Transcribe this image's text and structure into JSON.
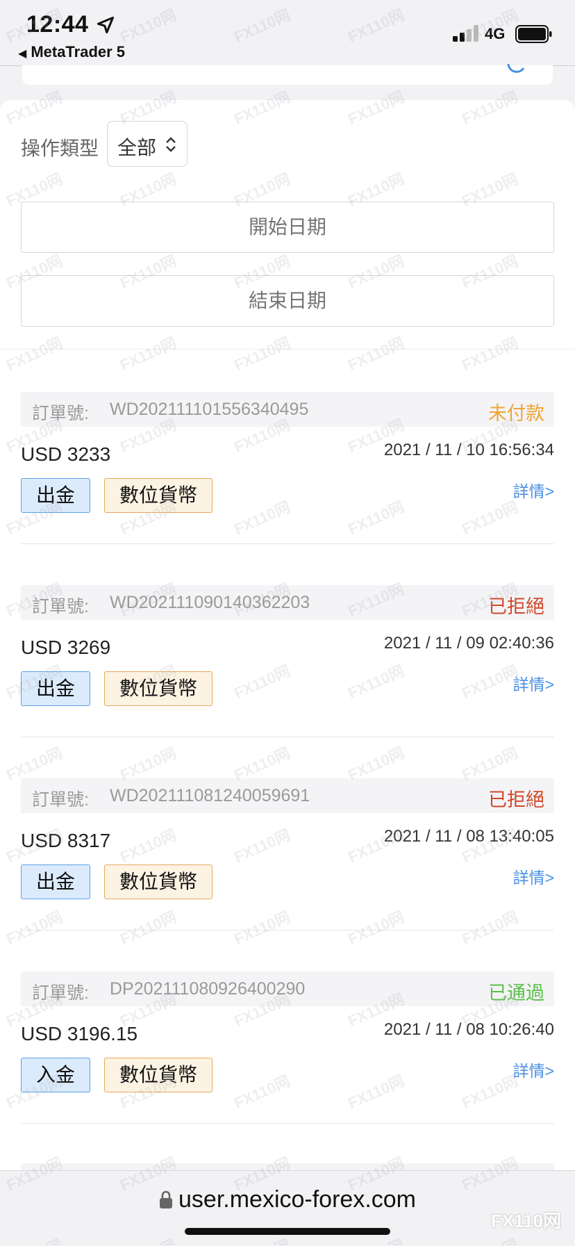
{
  "status_bar": {
    "time": "12:44",
    "back_app": "MetaTrader 5",
    "network": "4G"
  },
  "filters": {
    "operation_type_label": "操作類型",
    "operation_type_value": "全部",
    "start_date_placeholder": "開始日期",
    "end_date_placeholder": "結束日期"
  },
  "orders": [
    {
      "order_no_label": "訂單號:",
      "order_no": "WD202111101556340495",
      "status": "未付款",
      "status_color": "#f0a431",
      "amount": "USD 3233",
      "datetime": "2021 / 11 / 10 16:56:34",
      "type": "出金",
      "method": "數位貨幣",
      "detail": "詳情>"
    },
    {
      "order_no_label": "訂單號:",
      "order_no": "WD202111090140362203",
      "status": "已拒絕",
      "status_color": "#d0482a",
      "amount": "USD 3269",
      "datetime": "2021 / 11 / 09 02:40:36",
      "type": "出金",
      "method": "數位貨幣",
      "detail": "詳情>"
    },
    {
      "order_no_label": "訂單號:",
      "order_no": "WD202111081240059691",
      "status": "已拒絕",
      "status_color": "#d0482a",
      "amount": "USD 8317",
      "datetime": "2021 / 11 / 08 13:40:05",
      "type": "出金",
      "method": "數位貨幣",
      "detail": "詳情>"
    },
    {
      "order_no_label": "訂單號:",
      "order_no": "DP202111080926400290",
      "status": "已通過",
      "status_color": "#5cc04a",
      "amount": "USD 3196.15",
      "datetime": "2021 / 11 / 08 10:26:40",
      "type": "入金",
      "method": "數位貨幣",
      "detail": "詳情>"
    }
  ],
  "browser": {
    "url": "user.mexico-forex.com"
  },
  "watermark": {
    "text": "FX110网"
  },
  "colors": {
    "link": "#4a90e2",
    "tag_type_border": "#5a9ee8",
    "tag_method_border": "#e8a75a"
  },
  "icons": {
    "location": "location-arrow-icon",
    "signal": "cell-signal-icon",
    "battery": "battery-icon",
    "search": "search-icon",
    "select_chevron": "chevron-up-down-icon",
    "lock": "lock-icon"
  }
}
